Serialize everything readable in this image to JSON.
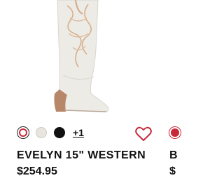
{
  "product": {
    "image_icon": "boot-image",
    "swatches": [
      {
        "name": "white-with-red",
        "color": "#ffffff",
        "ring": "#c62a3a",
        "selected": true
      },
      {
        "name": "bone",
        "color": "#e8e5de",
        "ring": "#cfcac0",
        "selected": false
      },
      {
        "name": "black",
        "color": "#111111",
        "ring": "#111111",
        "selected": false
      }
    ],
    "more_colors_label": "+1",
    "wishlist_icon": "heart-icon",
    "title": "EVELYN 15\" WESTERN",
    "price": "$254.95"
  },
  "next_product": {
    "swatch_color": "#c62a3a",
    "title_fragment": "B",
    "price_fragment": "$"
  },
  "colors": {
    "text": "#111111",
    "accent": "#c62a3a"
  }
}
